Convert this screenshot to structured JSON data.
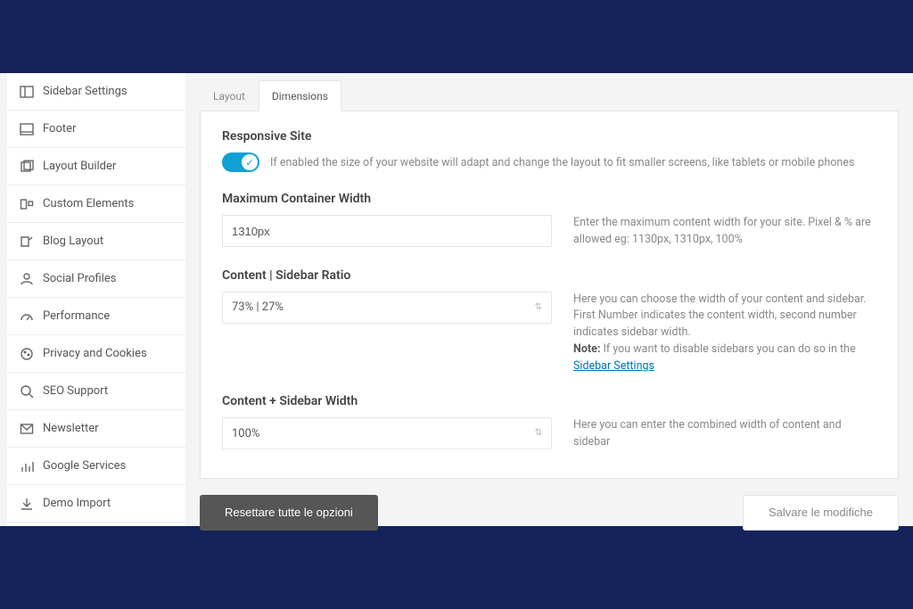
{
  "sidebar": {
    "items": [
      {
        "label": "Sidebar Settings"
      },
      {
        "label": "Footer"
      },
      {
        "label": "Layout Builder"
      },
      {
        "label": "Custom Elements"
      },
      {
        "label": "Blog Layout"
      },
      {
        "label": "Social Profiles"
      },
      {
        "label": "Performance"
      },
      {
        "label": "Privacy and Cookies"
      },
      {
        "label": "SEO Support"
      },
      {
        "label": "Newsletter"
      },
      {
        "label": "Google Services"
      },
      {
        "label": "Demo Import"
      }
    ]
  },
  "tabs": {
    "layout": "Layout",
    "dimensions": "Dimensions"
  },
  "responsive": {
    "title": "Responsive Site",
    "desc": "If enabled the size of your website will adapt and change the layout to fit smaller screens, like tablets or mobile phones"
  },
  "max_width": {
    "title": "Maximum Container Width",
    "value": "1310px",
    "hint": "Enter the maximum content width for your site. Pixel & % are allowed eg: 1130px, 1310px, 100%"
  },
  "ratio": {
    "title": "Content | Sidebar Ratio",
    "value": "73% | 27%",
    "hint_line1": "Here you can choose the width of your content and sidebar. First Number indicates the content width, second number indicates sidebar width.",
    "note_label": "Note:",
    "note_text": "If you want to disable sidebars you can do so in the ",
    "note_link": "Sidebar Settings"
  },
  "combined": {
    "title": "Content + Sidebar Width",
    "value": "100%",
    "hint": "Here you can enter the combined width of content and sidebar"
  },
  "actions": {
    "reset": "Resettare tutte le opzioni",
    "save": "Salvare le modifiche"
  }
}
